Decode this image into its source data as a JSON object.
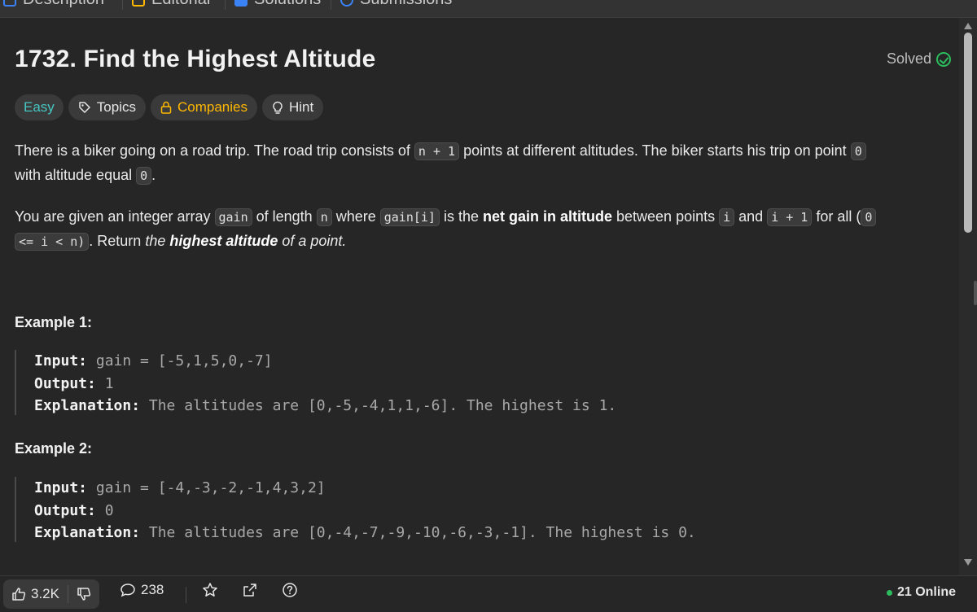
{
  "tabs": [
    {
      "label": "Description",
      "icon": "description-icon",
      "color": "#3b82f6"
    },
    {
      "label": "Editorial",
      "icon": "book-icon",
      "color": "#ffb800"
    },
    {
      "label": "Solutions",
      "icon": "flask-icon",
      "color": "#3b82f6"
    },
    {
      "label": "Submissions",
      "icon": "history-icon",
      "color": "#3b82f6"
    }
  ],
  "problem": {
    "title": "1732. Find the Highest Altitude",
    "status": "Solved"
  },
  "tags": {
    "difficulty": "Easy",
    "topics": "Topics",
    "companies": "Companies",
    "hint": "Hint"
  },
  "description": {
    "p1_a": "There is a biker going on a road trip. The road trip consists of ",
    "p1_code1": "n + 1",
    "p1_b": " points at different altitudes. The biker starts his trip on point ",
    "p1_code2": "0",
    "p1_c": "with altitude equal ",
    "p1_code3": "0",
    "p1_d": ".",
    "p2_a": "You are given an integer array ",
    "p2_code1": "gain",
    "p2_b": " of length ",
    "p2_code2": "n",
    "p2_c": " where ",
    "p2_code3": "gain[i]",
    "p2_d": " is the ",
    "p2_bold1": "net gain in altitude",
    "p2_e": " between points ",
    "p2_code4": "i",
    "p2_f": " and ",
    "p2_code5": "i + 1",
    "p2_g": " for all (",
    "p2_code6a": "0",
    "p2_code6b": "<= i < n)",
    "p2_h": ". Return ",
    "p2_em1": "the ",
    "p2_em_bold": "highest altitude",
    "p2_em2": " of a point."
  },
  "examples": [
    {
      "title": "Example 1:",
      "input_label": "Input:",
      "input": " gain = [-5,1,5,0,-7]",
      "output_label": "Output:",
      "output": " 1",
      "explanation_label": "Explanation:",
      "explanation": " The altitudes are [0,-5,-4,1,1,-6]. The highest is 1."
    },
    {
      "title": "Example 2:",
      "input_label": "Input:",
      "input": " gain = [-4,-3,-2,-1,4,3,2]",
      "output_label": "Output:",
      "output": " 0",
      "explanation_label": "Explanation:",
      "explanation": " The altitudes are [0,-4,-7,-9,-10,-6,-3,-1]. The highest is 0."
    }
  ],
  "bottombar": {
    "likes": "3.2K",
    "comments": "238",
    "online": "21 Online"
  },
  "colors": {
    "easy": "#46c6c2",
    "companies": "#ffb800",
    "solved": "#2cbb5d",
    "online_dot": "#2cbb5d"
  }
}
